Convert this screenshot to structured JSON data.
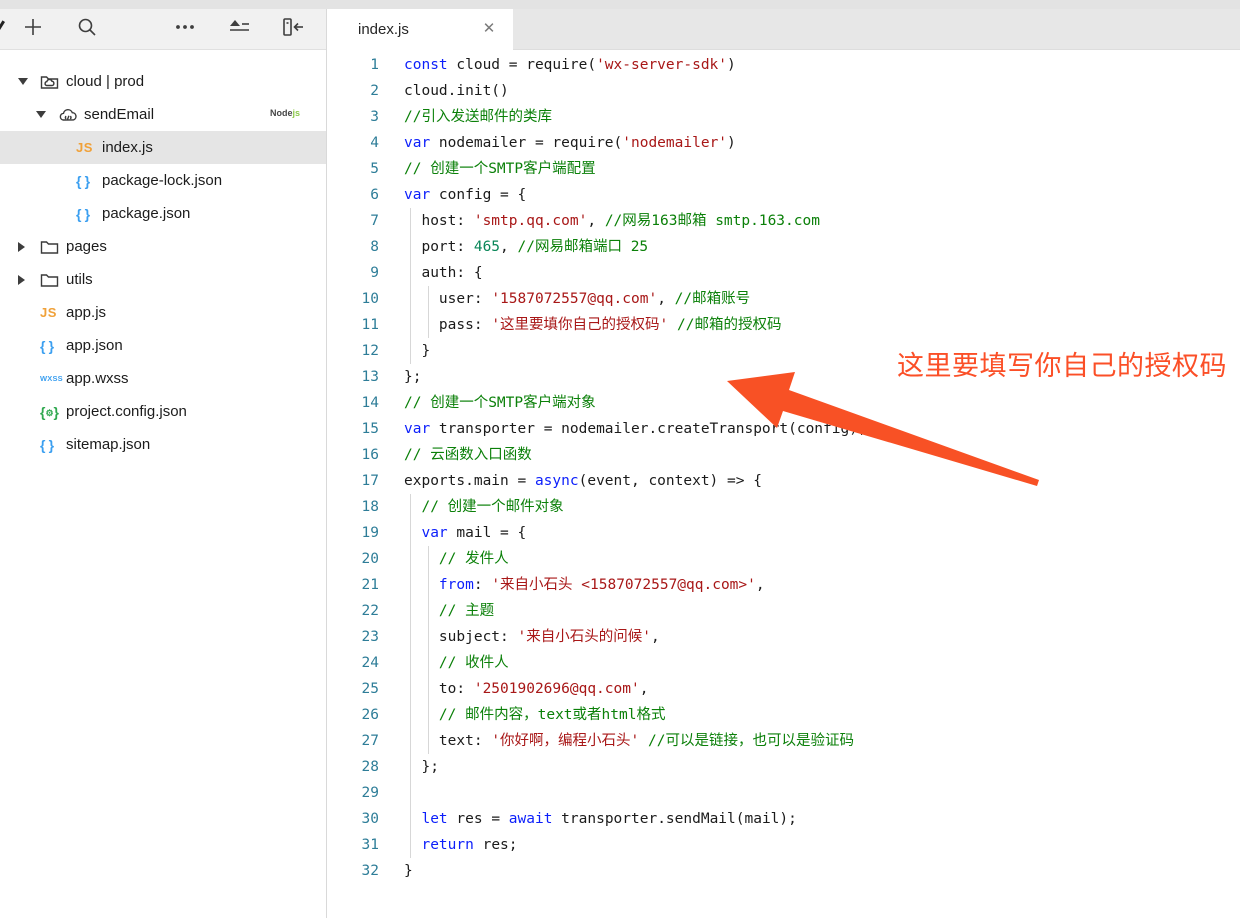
{
  "sidebar": {
    "toolbar": {
      "icons": [
        "add-icon",
        "search-icon",
        "more-icon",
        "collapse-list-icon",
        "hide-sidebar-icon"
      ]
    },
    "tree": [
      {
        "label": "cloud | prod",
        "icon": "folder-cloud",
        "level": 0,
        "expanded": true
      },
      {
        "label": "sendEmail",
        "icon": "cloud-function",
        "level": 1,
        "expanded": true,
        "badge": "Nodejs"
      },
      {
        "label": "index.js",
        "icon": "js",
        "level": 2,
        "selected": true
      },
      {
        "label": "package-lock.json",
        "icon": "json",
        "level": 2
      },
      {
        "label": "package.json",
        "icon": "json",
        "level": 2
      },
      {
        "label": "pages",
        "icon": "folder",
        "level": 0,
        "collapsed": true
      },
      {
        "label": "utils",
        "icon": "folder",
        "level": 0,
        "collapsed": true
      },
      {
        "label": "app.js",
        "icon": "js",
        "level": 0
      },
      {
        "label": "app.json",
        "icon": "json",
        "level": 0
      },
      {
        "label": "app.wxss",
        "icon": "wxss",
        "level": 0
      },
      {
        "label": "project.config.json",
        "icon": "json-config",
        "level": 0
      },
      {
        "label": "sitemap.json",
        "icon": "json",
        "level": 0
      }
    ]
  },
  "editor": {
    "tab": {
      "label": "index.js",
      "close_label": "✕"
    },
    "annotation": {
      "text": "这里要填写你自己的授权码",
      "color": "#fb4f27"
    },
    "lines": [
      {
        "n": 1,
        "segs": [
          [
            "const",
            "k"
          ],
          [
            " cloud = require(",
            "p"
          ],
          [
            "'wx-server-sdk'",
            "s"
          ],
          [
            ")",
            "p"
          ]
        ]
      },
      {
        "n": 2,
        "segs": [
          [
            "cloud.init()",
            "p"
          ]
        ]
      },
      {
        "n": 3,
        "segs": [
          [
            "//引入发送邮件的类库",
            "c"
          ]
        ]
      },
      {
        "n": 4,
        "segs": [
          [
            "var",
            "k"
          ],
          [
            " nodemailer = require(",
            "p"
          ],
          [
            "'nodemailer'",
            "s"
          ],
          [
            ")",
            "p"
          ]
        ]
      },
      {
        "n": 5,
        "segs": [
          [
            "// 创建一个SMTP客户端配置",
            "c"
          ]
        ]
      },
      {
        "n": 6,
        "segs": [
          [
            "var",
            "k"
          ],
          [
            " config = {",
            "p"
          ]
        ]
      },
      {
        "n": 7,
        "segs": [
          [
            "  host: ",
            "p"
          ],
          [
            "'smtp.qq.com'",
            "s"
          ],
          [
            ", ",
            "p"
          ],
          [
            "//网易163邮箱 smtp.163.com",
            "c"
          ]
        ]
      },
      {
        "n": 8,
        "segs": [
          [
            "  port: ",
            "p"
          ],
          [
            "465",
            "n"
          ],
          [
            ", ",
            "p"
          ],
          [
            "//网易邮箱端口 25",
            "c"
          ]
        ]
      },
      {
        "n": 9,
        "segs": [
          [
            "  auth: {",
            "p"
          ]
        ]
      },
      {
        "n": 10,
        "segs": [
          [
            "    user: ",
            "p"
          ],
          [
            "'1587072557@qq.com'",
            "s"
          ],
          [
            ", ",
            "p"
          ],
          [
            "//邮箱账号",
            "c"
          ]
        ]
      },
      {
        "n": 11,
        "segs": [
          [
            "    pass: ",
            "p"
          ],
          [
            "'这里要填你自己的授权码'",
            "s"
          ],
          [
            " ",
            "p"
          ],
          [
            "//邮箱的授权码",
            "c"
          ]
        ]
      },
      {
        "n": 12,
        "segs": [
          [
            "  }",
            "p"
          ]
        ]
      },
      {
        "n": 13,
        "segs": [
          [
            "};",
            "p"
          ]
        ]
      },
      {
        "n": 14,
        "segs": [
          [
            "// 创建一个SMTP客户端对象",
            "c"
          ]
        ]
      },
      {
        "n": 15,
        "segs": [
          [
            "var",
            "k"
          ],
          [
            " transporter = nodemailer.createTransport(config);",
            "p"
          ]
        ]
      },
      {
        "n": 16,
        "segs": [
          [
            "// 云函数入口函数",
            "c"
          ]
        ]
      },
      {
        "n": 17,
        "segs": [
          [
            "exports.main = ",
            "p"
          ],
          [
            "async",
            "k"
          ],
          [
            "(event, context) => {",
            "p"
          ]
        ]
      },
      {
        "n": 18,
        "segs": [
          [
            "  // 创建一个邮件对象",
            "c"
          ]
        ]
      },
      {
        "n": 19,
        "segs": [
          [
            "  ",
            "p"
          ],
          [
            "var",
            "k"
          ],
          [
            " mail = {",
            "p"
          ]
        ]
      },
      {
        "n": 20,
        "segs": [
          [
            "    // 发件人",
            "c"
          ]
        ]
      },
      {
        "n": 21,
        "segs": [
          [
            "    ",
            "p"
          ],
          [
            "from",
            "k"
          ],
          [
            ": ",
            "p"
          ],
          [
            "'来自小石头 <1587072557@qq.com>'",
            "s"
          ],
          [
            ",",
            "p"
          ]
        ]
      },
      {
        "n": 22,
        "segs": [
          [
            "    // 主题",
            "c"
          ]
        ]
      },
      {
        "n": 23,
        "segs": [
          [
            "    subject: ",
            "p"
          ],
          [
            "'来自小石头的问候'",
            "s"
          ],
          [
            ",",
            "p"
          ]
        ]
      },
      {
        "n": 24,
        "segs": [
          [
            "    // 收件人",
            "c"
          ]
        ]
      },
      {
        "n": 25,
        "segs": [
          [
            "    to: ",
            "p"
          ],
          [
            "'2501902696@qq.com'",
            "s"
          ],
          [
            ",",
            "p"
          ]
        ]
      },
      {
        "n": 26,
        "segs": [
          [
            "    // 邮件内容，text或者html格式",
            "c"
          ]
        ]
      },
      {
        "n": 27,
        "segs": [
          [
            "    text: ",
            "p"
          ],
          [
            "'你好啊，编程小石头'",
            "s"
          ],
          [
            " ",
            "p"
          ],
          [
            "//可以是链接，也可以是验证码",
            "c"
          ]
        ]
      },
      {
        "n": 28,
        "segs": [
          [
            "  };",
            "p"
          ]
        ]
      },
      {
        "n": 29,
        "segs": []
      },
      {
        "n": 30,
        "segs": [
          [
            "  ",
            "p"
          ],
          [
            "let",
            "k"
          ],
          [
            " res = ",
            "p"
          ],
          [
            "await",
            "k"
          ],
          [
            " transporter.sendMail(mail);",
            "p"
          ]
        ]
      },
      {
        "n": 31,
        "segs": [
          [
            "  ",
            "p"
          ],
          [
            "return",
            "k"
          ],
          [
            " res;",
            "p"
          ]
        ]
      },
      {
        "n": 32,
        "segs": [
          [
            "}",
            "p"
          ]
        ]
      }
    ]
  },
  "colors": {
    "keyword": "#0c1ffb",
    "string": "#a81717",
    "comment": "#0b8009",
    "number": "#098658",
    "line_number": "#2e7d98",
    "annotation_arrow": "#f85125",
    "js_icon": "#f0a139",
    "json_icon": "#3b9ff0",
    "config_icon": "#2fa84f",
    "node_badge_green": "#8cc84b",
    "selected_row_bg": "#e5e5e5"
  }
}
